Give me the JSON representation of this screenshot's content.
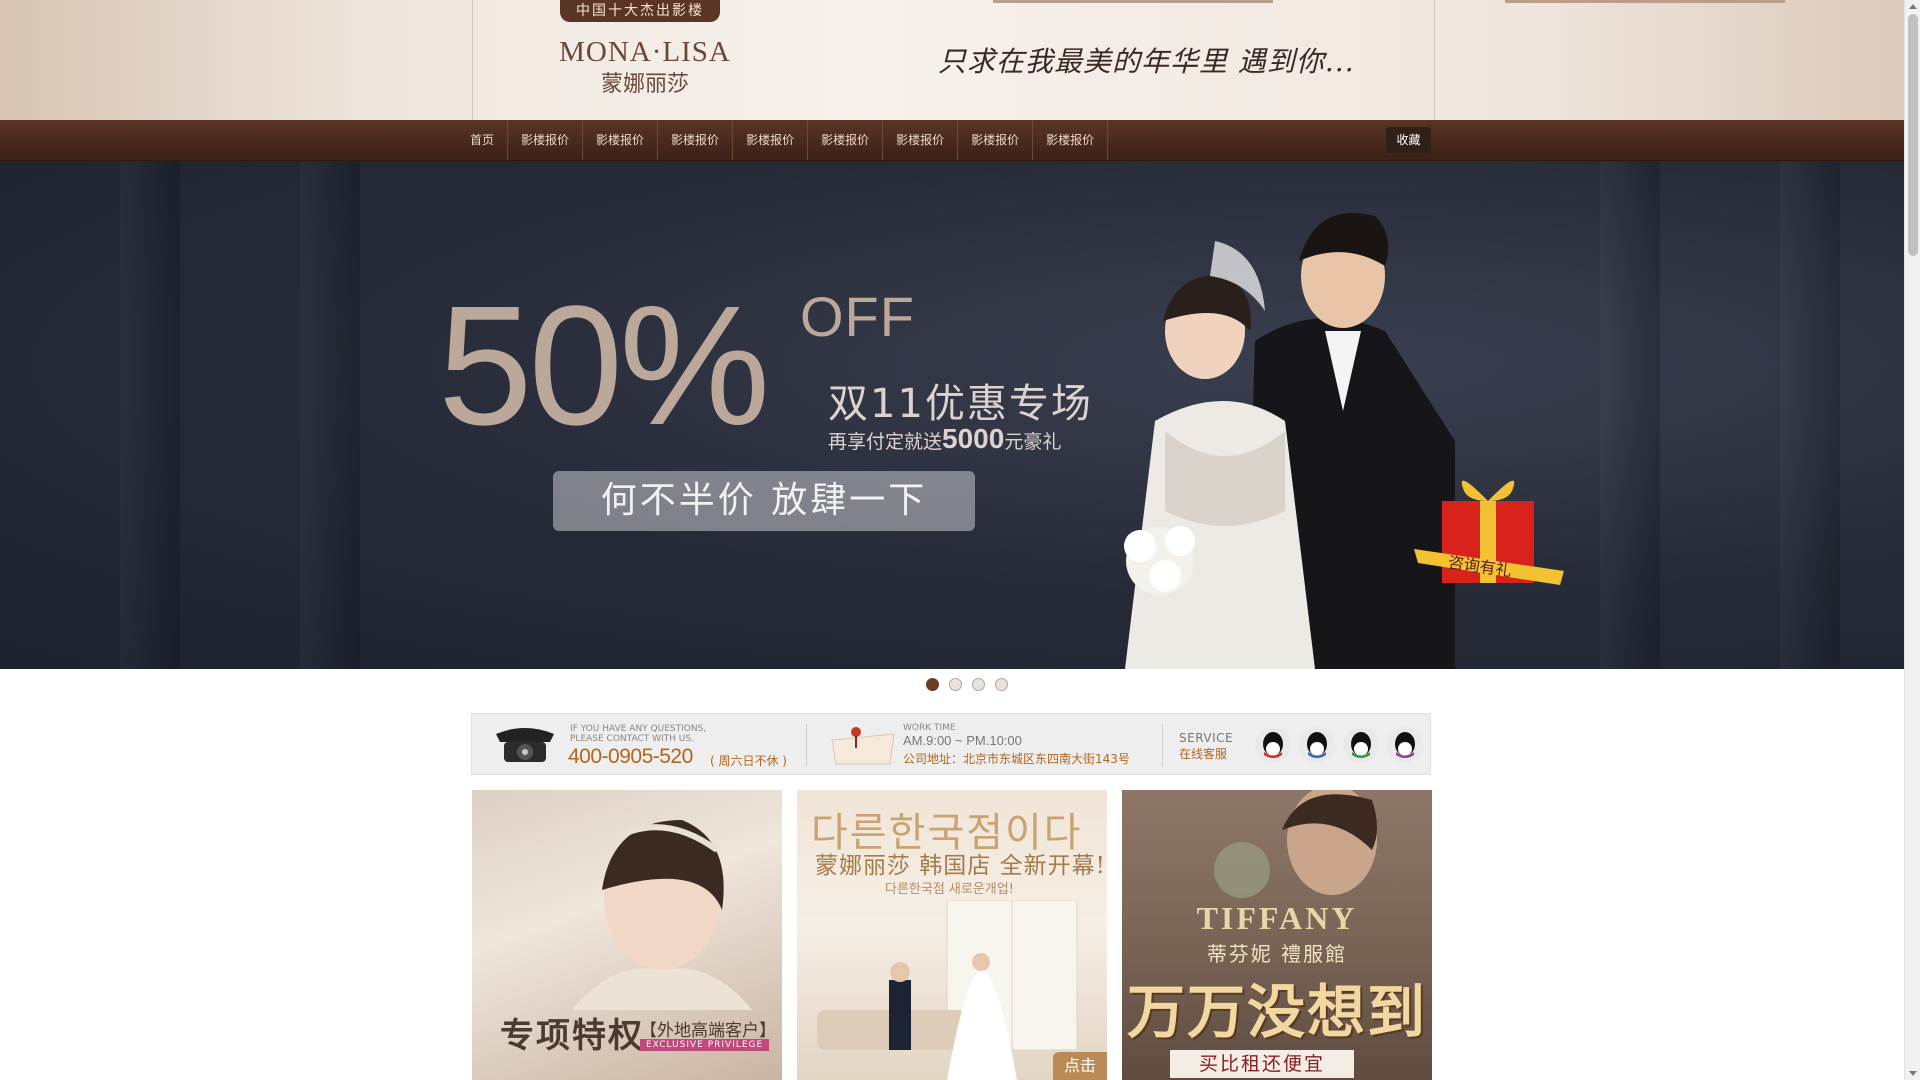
{
  "header": {
    "badge": "中国十大杰出影楼",
    "logo_en": "MONA·LISA",
    "logo_cn": "蒙娜丽莎",
    "slogan": "只求在我最美的年华里 遇到你..."
  },
  "nav": {
    "items": [
      "首页",
      "影楼报价",
      "影楼报价",
      "影楼报价",
      "影楼报价",
      "影楼报价",
      "影楼报价",
      "影楼报价",
      "影楼报价"
    ],
    "favorite": "收藏"
  },
  "banner": {
    "discount": "50%",
    "off": "OFF",
    "title": "双11优惠专场",
    "sub_prefix": "再享付定就送",
    "sub_amount": "5000",
    "sub_suffix": "元豪礼",
    "pill": "何不半价 放肆一下",
    "gift_label": "咨询有礼",
    "slides": 4,
    "active_slide": 1
  },
  "contact": {
    "question_line1": "IF YOU HAVE ANY QUESTIONS,",
    "question_line2": "PLEASE CONTACT WITH US.",
    "hotline": "400-0905-520",
    "hotline_note": "( 周六日不休 )",
    "work_label": "WORK TIME",
    "work_time": "AM.9:00 ~ PM.10:00",
    "address": "公司地址：北京市东城区东四南大街143号",
    "service_en": "SERVICE",
    "service_cn": "在线客服"
  },
  "tiles": {
    "t1_main": "专项特权",
    "t1_tag": "【外地高端客户】",
    "t1_en": "EXCLUSIVE PRIVILEGE",
    "t2_kor": "다른한국점이다",
    "t2_cn": "蒙娜丽莎 韩国店 全新开幕!",
    "t2_kor_small": "다른한국점 새로운개업!",
    "t2_tap": "点击",
    "t3_en": "TIFFANY",
    "t3_cn": "蒂芬妮 禮服館",
    "t3_big": "万万没想到",
    "t3_cheaper": "买比租还便宜"
  },
  "colors": {
    "nav_bg": "#4a2b1e",
    "accent": "#b5651d",
    "dot_active": "#6a3d25"
  }
}
